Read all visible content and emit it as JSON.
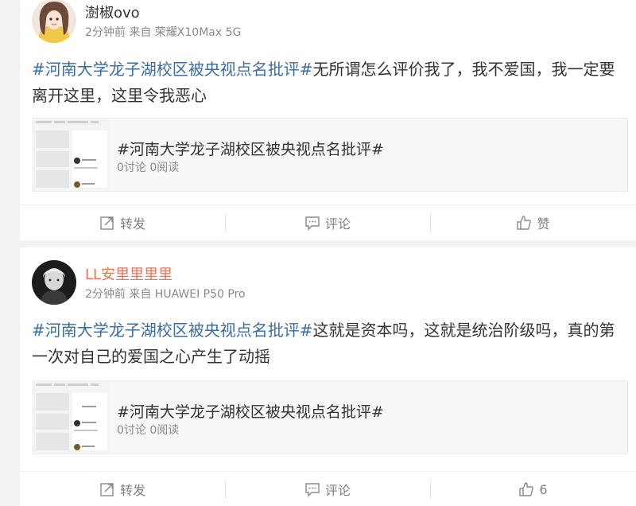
{
  "posts": [
    {
      "username": "澍椒ovo",
      "meta": "2分钟前 来自 荣耀X10Max 5G",
      "hashtag": "#河南大学龙子湖校区被央视点名批评#",
      "text": "无所谓怎么评价我了，我不爱国，我一定要离开这里，这里令我恶心",
      "share": {
        "title": "#河南大学龙子湖校区被央视点名批评#",
        "stats": "0讨论 0阅读"
      },
      "actions": {
        "repost": "转发",
        "comment": "评论",
        "like": "赞"
      }
    },
    {
      "username": "LL安里里里里",
      "meta": "2分钟前 来自 HUAWEI P50 Pro",
      "hashtag": "#河南大学龙子湖校区被央视点名批评#",
      "text": "这就是资本吗，这就是统治阶级吗，真的第一次对自己的爱国之心产生了动摇",
      "share": {
        "title": "#河南大学龙子湖校区被央视点名批评#",
        "stats": "0讨论 0阅读"
      },
      "actions": {
        "repost": "转发",
        "comment": "评论",
        "like": "6"
      }
    }
  ],
  "icons": {
    "repost": "repost-icon",
    "comment": "comment-icon",
    "like": "thumbs-up-icon"
  },
  "colors": {
    "hashtag": "#3b6ea5",
    "username_highlight": "#eb7350",
    "meta": "#8a8a8a",
    "background": "#f2f2f5"
  }
}
